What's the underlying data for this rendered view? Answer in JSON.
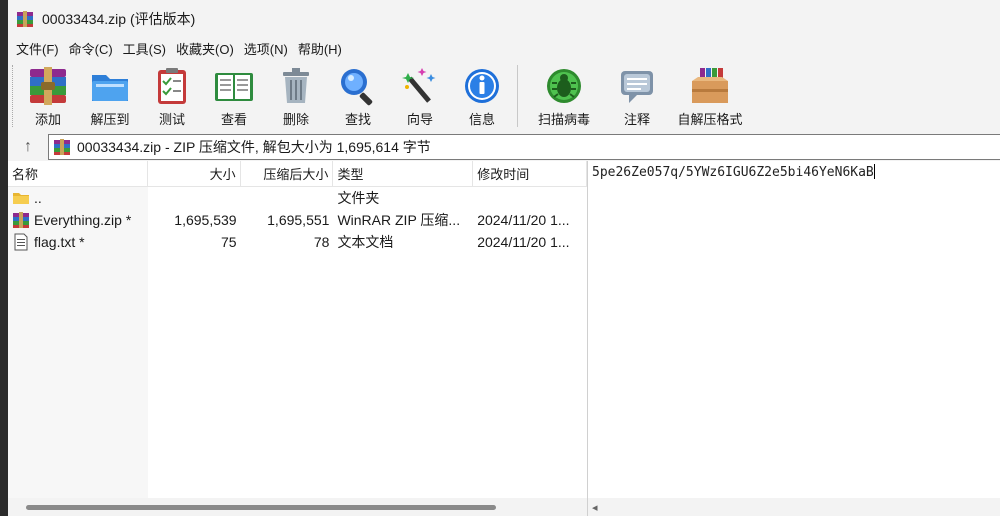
{
  "window": {
    "title": "00033434.zip (评估版本)"
  },
  "menu": [
    "文件(F)",
    "命令(C)",
    "工具(S)",
    "收藏夹(O)",
    "选项(N)",
    "帮助(H)"
  ],
  "toolbar": {
    "add": "添加",
    "extract_to": "解压到",
    "test": "测试",
    "view": "查看",
    "delete": "删除",
    "find": "查找",
    "wizard": "向导",
    "info": "信息",
    "virus_scan": "扫描病毒",
    "comment": "注释",
    "sfx": "自解压格式"
  },
  "path": {
    "text": "00033434.zip - ZIP 压缩文件, 解包大小为 1,695,614 字节",
    "up_arrow": "↑"
  },
  "columns": {
    "name": "名称",
    "size": "大小",
    "packed": "压缩后大小",
    "type": "类型",
    "modified": "修改时间"
  },
  "files": [
    {
      "name": "..",
      "size": "",
      "packed": "",
      "type": "文件夹",
      "modified": "",
      "icon": "folder-icon"
    },
    {
      "name": "Everything.zip *",
      "size": "1,695,539",
      "packed": "1,695,551",
      "type": "WinRAR ZIP 压缩...",
      "modified": "2024/11/20 1...",
      "icon": "winrar-archive-icon"
    },
    {
      "name": "flag.txt *",
      "size": "75",
      "packed": "78",
      "type": "文本文档",
      "modified": "2024/11/20 1...",
      "icon": "text-file-icon"
    }
  ],
  "comment_text": "5pe26Ze057q/5YWz6IGU6Z2e5bi46YeN6KaB",
  "colors": {
    "window_bg": "#f3f3f3",
    "pane_bg": "#ffffff",
    "accent_blue": "#1e6fd9"
  }
}
